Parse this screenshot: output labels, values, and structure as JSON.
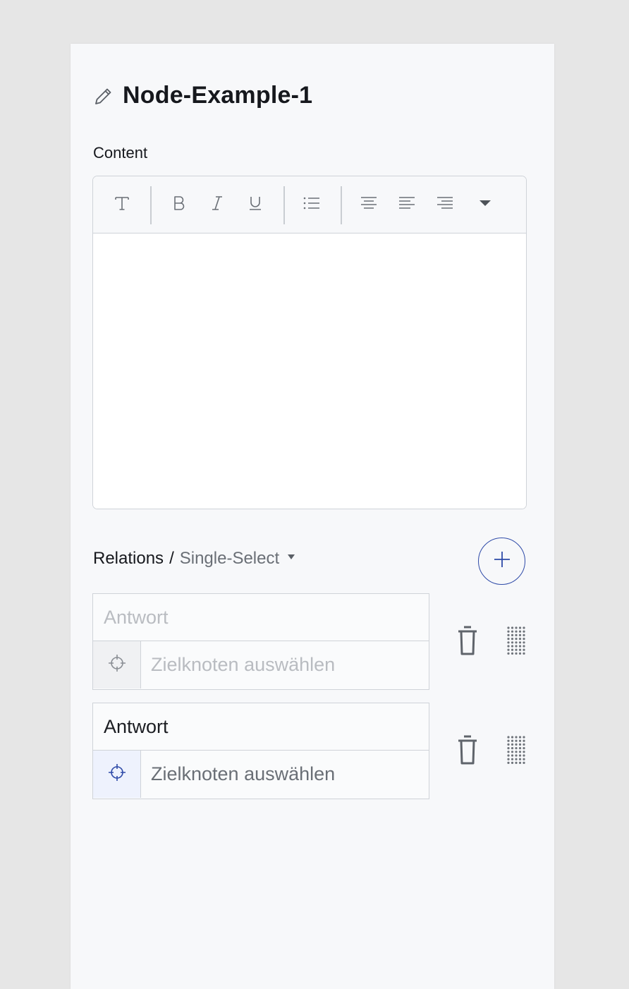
{
  "node": {
    "title": "Node-Example-1"
  },
  "content": {
    "label": "Content",
    "toolbar": [
      {
        "name": "text-style-button",
        "icon": "text-icon"
      },
      {
        "name": "bold-button",
        "icon": "bold-icon"
      },
      {
        "name": "italic-button",
        "icon": "italic-icon"
      },
      {
        "name": "underline-button",
        "icon": "underline-icon"
      },
      {
        "name": "bullet-list-button",
        "icon": "list-icon"
      },
      {
        "name": "align-center-button",
        "icon": "align-center-icon"
      },
      {
        "name": "align-left-button",
        "icon": "align-left-icon"
      },
      {
        "name": "align-right-button",
        "icon": "align-right-icon"
      },
      {
        "name": "more-options-button",
        "icon": "caret-down-icon"
      }
    ],
    "body": ""
  },
  "relations": {
    "label": "Relations",
    "separator": "/",
    "mode": "Single-Select",
    "add_icon": "plus-icon",
    "items": [
      {
        "answer_value": "",
        "answer_placeholder": "Antwort",
        "target_placeholder": "Zielknoten auswählen",
        "target_icon": "crosshair-icon",
        "active": false
      },
      {
        "answer_value": "Antwort",
        "answer_placeholder": "Antwort",
        "target_placeholder": "Zielknoten auswählen",
        "target_icon": "crosshair-icon",
        "active": true
      }
    ]
  },
  "colors": {
    "accent": "#2e4aa8",
    "page_bg": "#e6e6e6",
    "panel_bg": "#f7f8fa",
    "border": "#cfd3d8",
    "icon_grey": "#6a6f76"
  }
}
